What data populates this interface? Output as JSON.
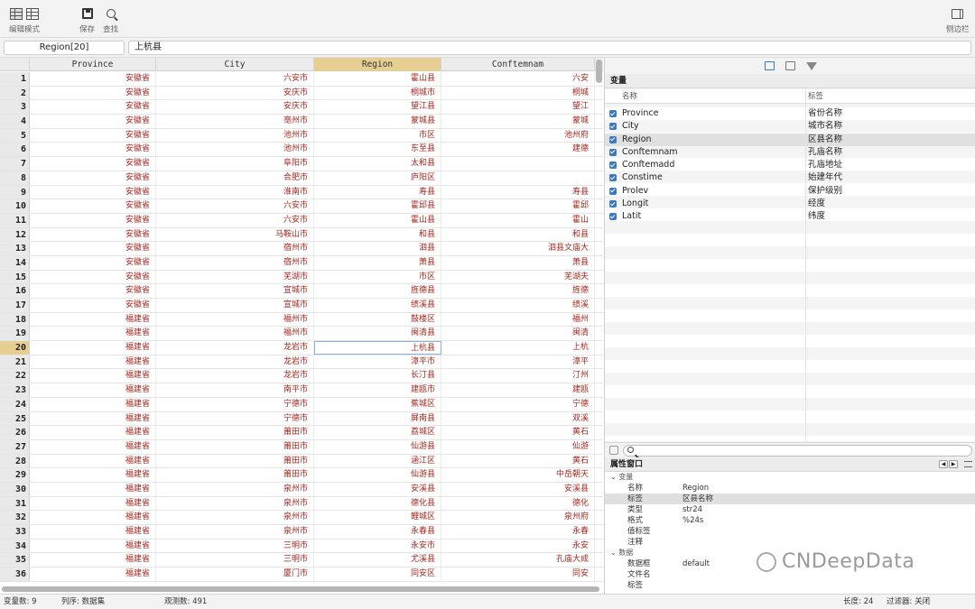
{
  "toolbar": {
    "edit_mode_label": "编辑模式",
    "save_label": "保存",
    "find_label": "查找",
    "sidebar_label": "侧边栏"
  },
  "cmdbar": {
    "cell_ref": "Region[20]",
    "cell_value": "上杭县"
  },
  "grid": {
    "columns": [
      "Province",
      "City",
      "Region",
      "Conftemnam"
    ],
    "selected_column": "Region",
    "selected_row": 20,
    "rows": [
      {
        "n": "1",
        "province": "安徽省",
        "city": "六安市",
        "region": "霍山县",
        "conf": "六安"
      },
      {
        "n": "2",
        "province": "安徽省",
        "city": "安庆市",
        "region": "桐城市",
        "conf": "桐城"
      },
      {
        "n": "3",
        "province": "安徽省",
        "city": "安庆市",
        "region": "望江县",
        "conf": "望江"
      },
      {
        "n": "4",
        "province": "安徽省",
        "city": "亳州市",
        "region": "蒙城县",
        "conf": "蒙城"
      },
      {
        "n": "5",
        "province": "安徽省",
        "city": "池州市",
        "region": "市区",
        "conf": "池州府"
      },
      {
        "n": "6",
        "province": "安徽省",
        "city": "池州市",
        "region": "东至县",
        "conf": "建德"
      },
      {
        "n": "7",
        "province": "安徽省",
        "city": "阜阳市",
        "region": "太和县",
        "conf": ""
      },
      {
        "n": "8",
        "province": "安徽省",
        "city": "合肥市",
        "region": "庐阳区",
        "conf": ""
      },
      {
        "n": "9",
        "province": "安徽省",
        "city": "淮南市",
        "region": "寿县",
        "conf": "寿县"
      },
      {
        "n": "10",
        "province": "安徽省",
        "city": "六安市",
        "region": "霍邱县",
        "conf": "霍邱"
      },
      {
        "n": "11",
        "province": "安徽省",
        "city": "六安市",
        "region": "霍山县",
        "conf": "霍山"
      },
      {
        "n": "12",
        "province": "安徽省",
        "city": "马鞍山市",
        "region": "和县",
        "conf": "和县"
      },
      {
        "n": "13",
        "province": "安徽省",
        "city": "宿州市",
        "region": "泗县",
        "conf": "泗县文庙大"
      },
      {
        "n": "14",
        "province": "安徽省",
        "city": "宿州市",
        "region": "萧县",
        "conf": "萧县"
      },
      {
        "n": "15",
        "province": "安徽省",
        "city": "芜湖市",
        "region": "市区",
        "conf": "芜湖夫"
      },
      {
        "n": "16",
        "province": "安徽省",
        "city": "宣城市",
        "region": "旌德县",
        "conf": "旌德"
      },
      {
        "n": "17",
        "province": "安徽省",
        "city": "宣城市",
        "region": "绩溪县",
        "conf": "绩溪"
      },
      {
        "n": "18",
        "province": "福建省",
        "city": "福州市",
        "region": "鼓楼区",
        "conf": "福州"
      },
      {
        "n": "19",
        "province": "福建省",
        "city": "福州市",
        "region": "闽清县",
        "conf": "闽清"
      },
      {
        "n": "20",
        "province": "福建省",
        "city": "龙岩市",
        "region": "上杭县",
        "conf": "上杭"
      },
      {
        "n": "21",
        "province": "福建省",
        "city": "龙岩市",
        "region": "漳平市",
        "conf": "漳平"
      },
      {
        "n": "22",
        "province": "福建省",
        "city": "龙岩市",
        "region": "长汀县",
        "conf": "汀州"
      },
      {
        "n": "23",
        "province": "福建省",
        "city": "南平市",
        "region": "建瓯市",
        "conf": "建瓯"
      },
      {
        "n": "24",
        "province": "福建省",
        "city": "宁德市",
        "region": "蕉城区",
        "conf": "宁德"
      },
      {
        "n": "25",
        "province": "福建省",
        "city": "宁德市",
        "region": "屏南县",
        "conf": "双溪"
      },
      {
        "n": "26",
        "province": "福建省",
        "city": "莆田市",
        "region": "荔城区",
        "conf": "黄石"
      },
      {
        "n": "27",
        "province": "福建省",
        "city": "莆田市",
        "region": "仙游县",
        "conf": "仙游"
      },
      {
        "n": "28",
        "province": "福建省",
        "city": "莆田市",
        "region": "涵江区",
        "conf": "黄石"
      },
      {
        "n": "29",
        "province": "福建省",
        "city": "莆田市",
        "region": "仙游县",
        "conf": "中岳朝天"
      },
      {
        "n": "30",
        "province": "福建省",
        "city": "泉州市",
        "region": "安溪县",
        "conf": "安溪县"
      },
      {
        "n": "31",
        "province": "福建省",
        "city": "泉州市",
        "region": "德化县",
        "conf": "德化"
      },
      {
        "n": "32",
        "province": "福建省",
        "city": "泉州市",
        "region": "鲤城区",
        "conf": "泉州府"
      },
      {
        "n": "33",
        "province": "福建省",
        "city": "泉州市",
        "region": "永春县",
        "conf": "永春"
      },
      {
        "n": "34",
        "province": "福建省",
        "city": "三明市",
        "region": "永安市",
        "conf": "永安"
      },
      {
        "n": "35",
        "province": "福建省",
        "city": "三明市",
        "region": "尤溪县",
        "conf": "孔庙大成"
      },
      {
        "n": "36",
        "province": "福建省",
        "city": "厦门市",
        "region": "同安区",
        "conf": "同安"
      }
    ]
  },
  "variables": {
    "title": "变量",
    "name_header": "名称",
    "label_header": "标签",
    "selected": "Region",
    "items": [
      {
        "name": "Province",
        "label": "省份名称"
      },
      {
        "name": "City",
        "label": "城市名称"
      },
      {
        "name": "Region",
        "label": "区县名称"
      },
      {
        "name": "Conftemnam",
        "label": "孔庙名称"
      },
      {
        "name": "Conftemadd",
        "label": "孔庙地址"
      },
      {
        "name": "Constime",
        "label": "始建年代"
      },
      {
        "name": "Prolev",
        "label": "保护级别"
      },
      {
        "name": "Longit",
        "label": "经度"
      },
      {
        "name": "Latit",
        "label": "纬度"
      }
    ]
  },
  "properties": {
    "title": "属性窗口",
    "group_variable": "变量",
    "group_data": "数据",
    "rows": [
      {
        "k": "名称",
        "v": "Region"
      },
      {
        "k": "标签",
        "v": "区县名称"
      },
      {
        "k": "类型",
        "v": "str24"
      },
      {
        "k": "格式",
        "v": "%24s"
      },
      {
        "k": "值标签",
        "v": ""
      },
      {
        "k": "注释",
        "v": ""
      }
    ],
    "data_rows": [
      {
        "k": "数据框",
        "v": "default"
      },
      {
        "k": "文件名",
        "v": ""
      },
      {
        "k": "标签",
        "v": ""
      }
    ]
  },
  "status": {
    "vars": "变量数: 9",
    "order": "列序: 数据集",
    "obs": "观测数: 491",
    "length": "长度: 24",
    "filter": "过滤器: 关闭"
  },
  "watermark": "CNDeepData",
  "colors": {
    "data_text": "#a4271f",
    "selection": "#e7cf93",
    "accent": "#3a78c8"
  }
}
